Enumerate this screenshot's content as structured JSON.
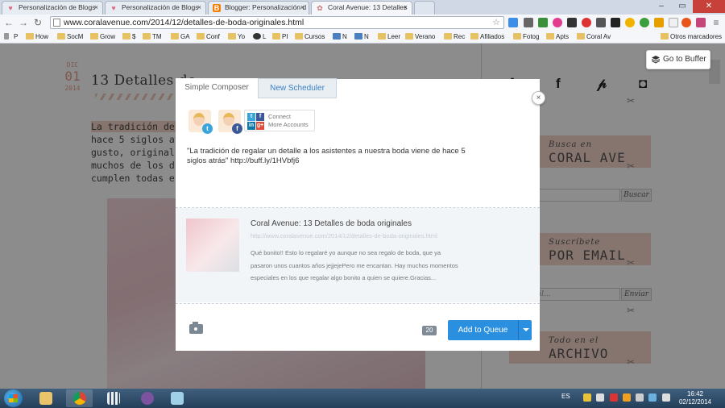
{
  "browser": {
    "tabs": [
      {
        "title": "Personalización de Blogs"
      },
      {
        "title": "Personalización de Blogs"
      },
      {
        "title": "Blogger: Personalización d"
      },
      {
        "title": "Coral Avenue: 13 Detalles"
      }
    ],
    "url": "www.coralavenue.com/2014/12/detalles-de-boda-originales.html",
    "bookmarks": [
      "P",
      "How",
      "SocM",
      "Grow",
      "$",
      "TM",
      "GA",
      "Conf",
      "Yo",
      "L",
      "PI",
      "Cursos",
      "N",
      "N",
      "Leer",
      "Verano",
      "Rec",
      "Afiliados",
      "Fotog",
      "Apts",
      "Coral Av"
    ],
    "other_bookmarks": "Otros marcadores"
  },
  "page": {
    "date_month": "DIC",
    "date_day": "01",
    "date_year": "2014",
    "post_title": "13 Detalles de",
    "post_lines": [
      "La tradición de re",
      "hace 5 siglos atrá",
      "gusto, original y e",
      "muchos de los d",
      "cumplen todas est"
    ],
    "go_to_buffer": "Go to Buffer",
    "sidebar": {
      "search_label1": "Busca en",
      "search_label2": "CORAL AVE",
      "search_button": "Buscar",
      "subscribe_label1": "Suscríbete",
      "subscribe_label2": "POR EMAIL",
      "email_placeholder": "ón email...",
      "send_button": "Enviar",
      "archive_label1": "Todo en el",
      "archive_label2": "ARCHIVO"
    }
  },
  "buffer": {
    "tab_simple": "Simple Composer",
    "tab_new": "New Scheduler",
    "close": "×",
    "connect_line1": "Connect",
    "connect_line2": "More Accounts",
    "message": "\"La tradición de regalar un detalle a los asistentes a nuestra boda viene de hace 5 siglos atrás\" http://buff.ly/1HVbfj6",
    "attachment": {
      "title": "Coral Avenue: 13 Detalles de boda originales",
      "url": "http://www.coralavenue.com/2014/12/detalles-de-boda-originales.html",
      "description": "Qué bonito!! Esto lo regalaré yo aunque no sea regalo de boda, que ya pasaron unos cuantos años jejjejePero me encantan. Hay muchos momentos especiales en los que regalar algo bonito a quien se quiere.Gracias..."
    },
    "char_count": "20",
    "add_to_queue": "Add to Queue"
  },
  "taskbar": {
    "language": "ES",
    "time": "16:42",
    "date": "02/12/2014"
  },
  "colors": {
    "buffer_blue": "#2b8fe0",
    "widget_pink": "#f5d3c8",
    "date_coral": "#e7a08b",
    "twitter": "#3aa4dd",
    "facebook": "#3b5998"
  }
}
